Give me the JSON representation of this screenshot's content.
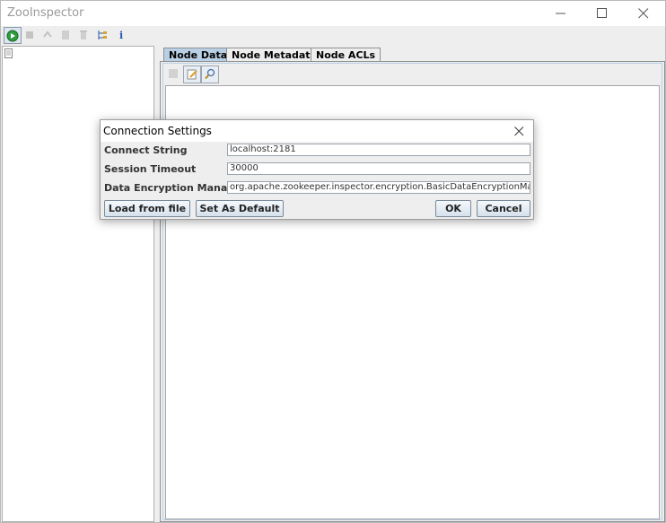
{
  "window": {
    "title": "ZooInspector"
  },
  "toolbar": {
    "buttons": [
      {
        "icon": "connect-icon",
        "color": "#2e9b3e"
      },
      {
        "icon": "disconnect-icon"
      },
      {
        "icon": "refresh-icon"
      },
      {
        "icon": "add-node-icon"
      },
      {
        "icon": "delete-node-icon"
      },
      {
        "icon": "node-viewers-icon"
      },
      {
        "icon": "about-icon"
      }
    ]
  },
  "tabs": [
    {
      "label": "Node Data",
      "active": true
    },
    {
      "label": "Node Metadata",
      "active": false
    },
    {
      "label": "Node ACLs",
      "active": false
    }
  ],
  "node_data_toolbar": {
    "buttons": [
      {
        "icon": "save-icon"
      },
      {
        "icon": "edit-icon"
      },
      {
        "icon": "search-icon"
      }
    ]
  },
  "dialog": {
    "title": "Connection Settings",
    "fields": [
      {
        "label": "Connect String",
        "value": "localhost:2181"
      },
      {
        "label": "Session Timeout",
        "value": "30000"
      },
      {
        "label": "Data Encryption Manager",
        "value": "org.apache.zookeeper.inspector.encryption.BasicDataEncryptionManager"
      }
    ],
    "buttons": {
      "load": "Load from file",
      "default": "Set As Default",
      "ok": "OK",
      "cancel": "Cancel"
    }
  },
  "colors": {
    "active_tab": "#b8cfe5",
    "button_border": "#7a8a99"
  }
}
